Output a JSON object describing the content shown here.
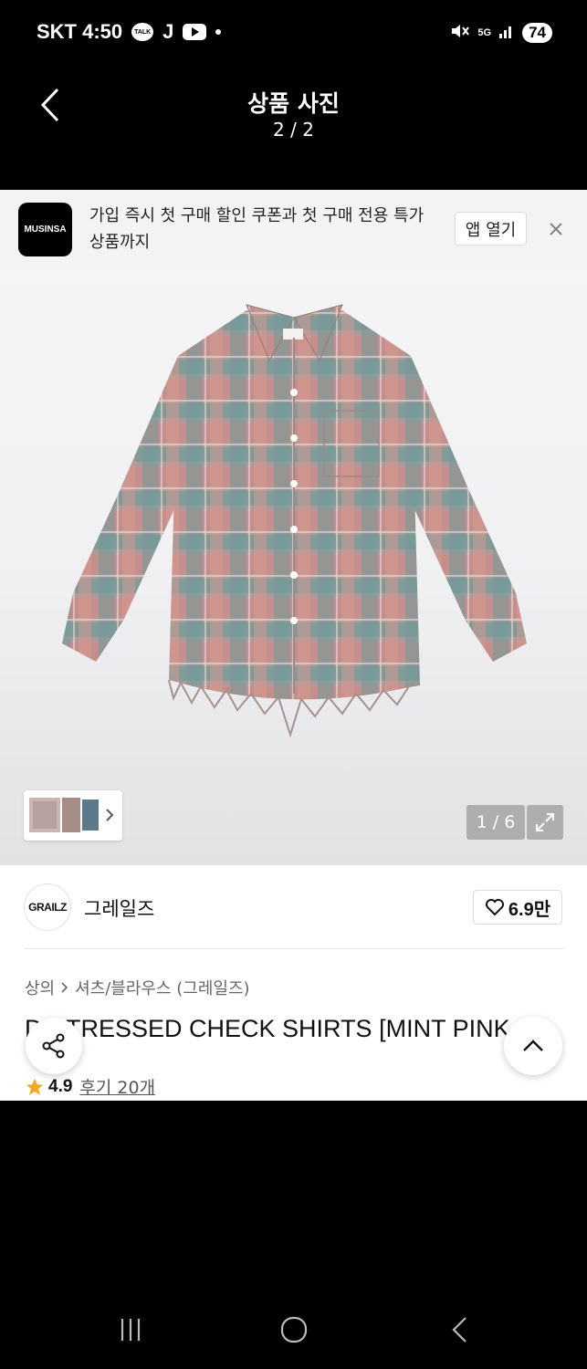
{
  "status_bar": {
    "carrier_time": "SKT 4:50",
    "talk_label": "TALK",
    "j_label": "J",
    "network": "5G",
    "battery": "74"
  },
  "header": {
    "title": "상품 사진",
    "page_indicator": "2 / 2"
  },
  "app_banner": {
    "logo_text": "MUSINSA",
    "message": "가입 즉시 첫 구매 할인 쿠폰과 첫 구매 전용 특가 상품까지",
    "open_app_label": "앱 열기"
  },
  "gallery": {
    "counter": "1 / 6"
  },
  "brand": {
    "logo_text": "GRAILZ",
    "name": "그레일즈",
    "likes": "6.9만"
  },
  "product": {
    "category": "상의",
    "subcategory": "셔츠/블라우스 (그레일즈)",
    "title": "DISTRESSED CHECK SHIRTS [MINT PINK]",
    "rating": "4.9",
    "reviews": "후기 20개"
  },
  "colors": {
    "accent_star": "#f5a623",
    "shirt_pink": "#c98a86",
    "shirt_teal": "#6f9a98"
  }
}
